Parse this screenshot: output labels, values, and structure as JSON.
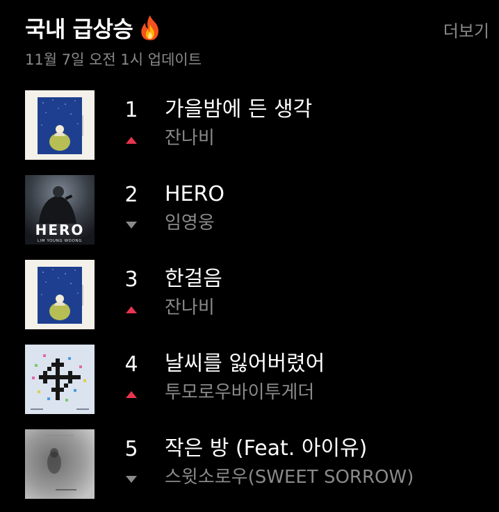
{
  "header": {
    "title": "국내 급상승",
    "title_icon": "fire-icon",
    "more_label": "더보기",
    "updated": "11월 7일 오전 1시 업데이트"
  },
  "colors": {
    "background": "#000000",
    "text_primary": "#ffffff",
    "text_secondary": "#8a8a8a",
    "trend_up": "#e8344e",
    "trend_down": "#8a8a8a"
  },
  "chart": [
    {
      "rank": "1",
      "title": "가을밤에 든 생각",
      "artist": "잔나비",
      "trend": "up",
      "trend_icon": "triangle-up-icon",
      "cover": "janabi-cover"
    },
    {
      "rank": "2",
      "title": "HERO",
      "artist": "임영웅",
      "trend": "down",
      "trend_icon": "triangle-down-icon",
      "cover": "hero-cover",
      "cover_text": "HERO",
      "cover_subtext": "LIM YOUNG WOONG"
    },
    {
      "rank": "3",
      "title": "한걸음",
      "artist": "잔나비",
      "trend": "up",
      "trend_icon": "triangle-up-icon",
      "cover": "janabi-cover"
    },
    {
      "rank": "4",
      "title": "날씨를 잃어버렸어",
      "artist": "투모로우바이투게더",
      "trend": "up",
      "trend_icon": "triangle-up-icon",
      "cover": "txt-cover"
    },
    {
      "rank": "5",
      "title": "작은 방 (Feat. 아이유)",
      "artist": "스윗소로우(SWEET SORROW)",
      "trend": "down",
      "trend_icon": "triangle-down-icon",
      "cover": "sweetsorrow-cover"
    }
  ]
}
